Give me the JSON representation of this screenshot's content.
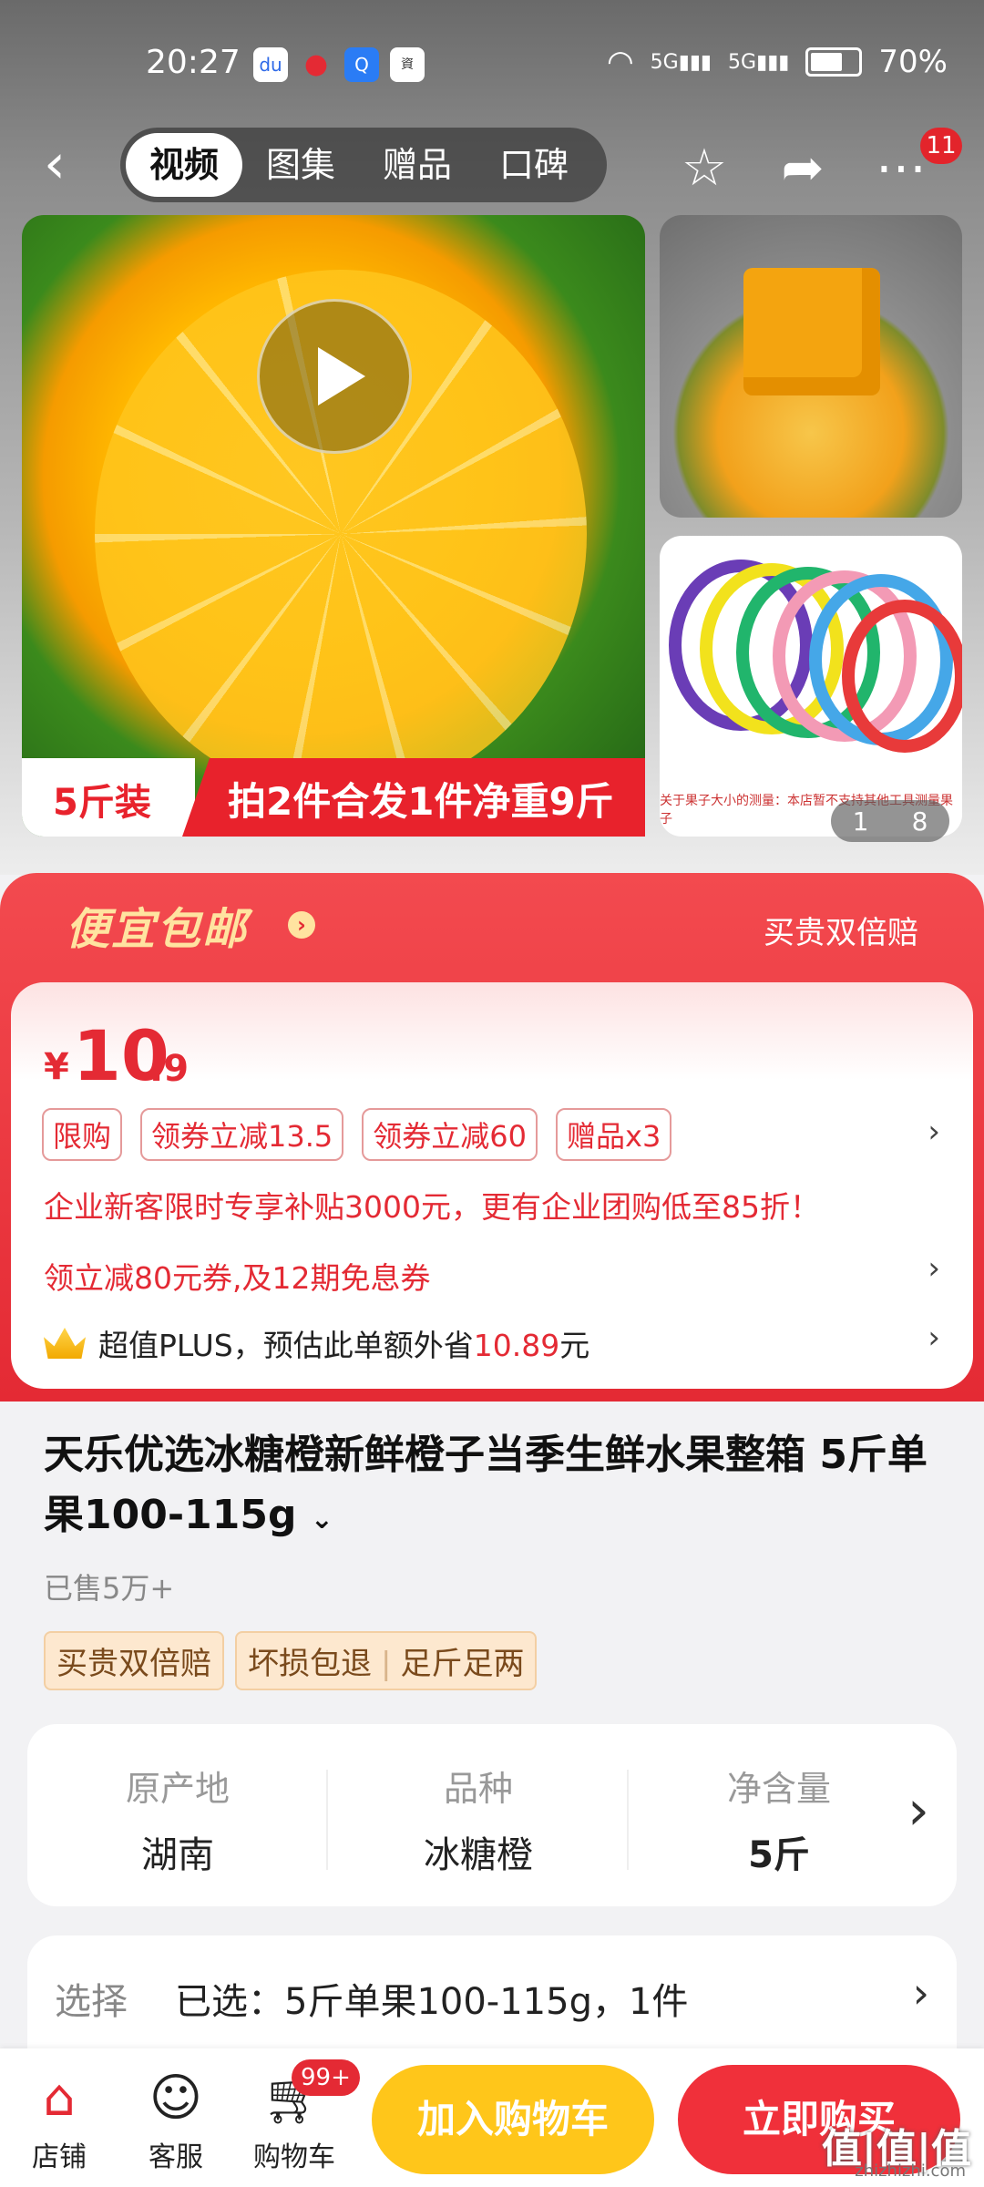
{
  "status_bar": {
    "time": "20:27",
    "battery": "70%",
    "signal1": "5G",
    "signal2": "5G"
  },
  "nav": {
    "tabs": [
      "视频",
      "图集",
      "赠品",
      "口碑"
    ],
    "more_badge": "11"
  },
  "gallery": {
    "banner_left": "5斤装",
    "banner_right": "拍2件合发1件净重9斤",
    "thumb2_caption": "关于果子大小的测量：本店暂不支持其他工具测量果子",
    "counter_current": "1",
    "counter_total": "8"
  },
  "promo": {
    "title": "便宜包邮",
    "right_text": "买贵双倍赔",
    "price_symbol": "¥",
    "price_int": "10",
    "price_dec": ".9",
    "tags": [
      "限购",
      "领券立减13.5",
      "领券立减60",
      "赠品x3"
    ],
    "enterprise_text": "企业新客限时专享补贴3000元，更有企业团购低至85折！",
    "coupon_text": "领立减80元券,及12期免息券",
    "plus_prefix": "超值PLUS，预估此单额外省",
    "plus_amount": "10.89",
    "plus_suffix": "元"
  },
  "product": {
    "title": "天乐优选冰糖橙新鲜橙子当季生鲜水果整箱 5斤单果100-115g",
    "sold": "已售5万+",
    "guarantees": [
      "买贵双倍赔",
      "坏损包退",
      "足斤足两"
    ]
  },
  "specs": [
    {
      "label": "原产地",
      "value": "湖南"
    },
    {
      "label": "品种",
      "value": "冰糖橙"
    },
    {
      "label": "净含量",
      "value": "5斤"
    }
  ],
  "selection": {
    "label": "选择",
    "value": "已选：5斤单果100-115g，1件"
  },
  "bottom_bar": {
    "shop": "店铺",
    "service": "客服",
    "cart": "购物车",
    "cart_badge": "99+",
    "add_to_cart": "加入购物车",
    "buy_now": "立即购买"
  },
  "watermark": {
    "main": "值|值|值",
    "sub": "zhizhizhi.com"
  },
  "colors": {
    "accent_red": "#e42a34",
    "cart_yellow": "#ffc61a",
    "buy_red": "#f0303a"
  }
}
